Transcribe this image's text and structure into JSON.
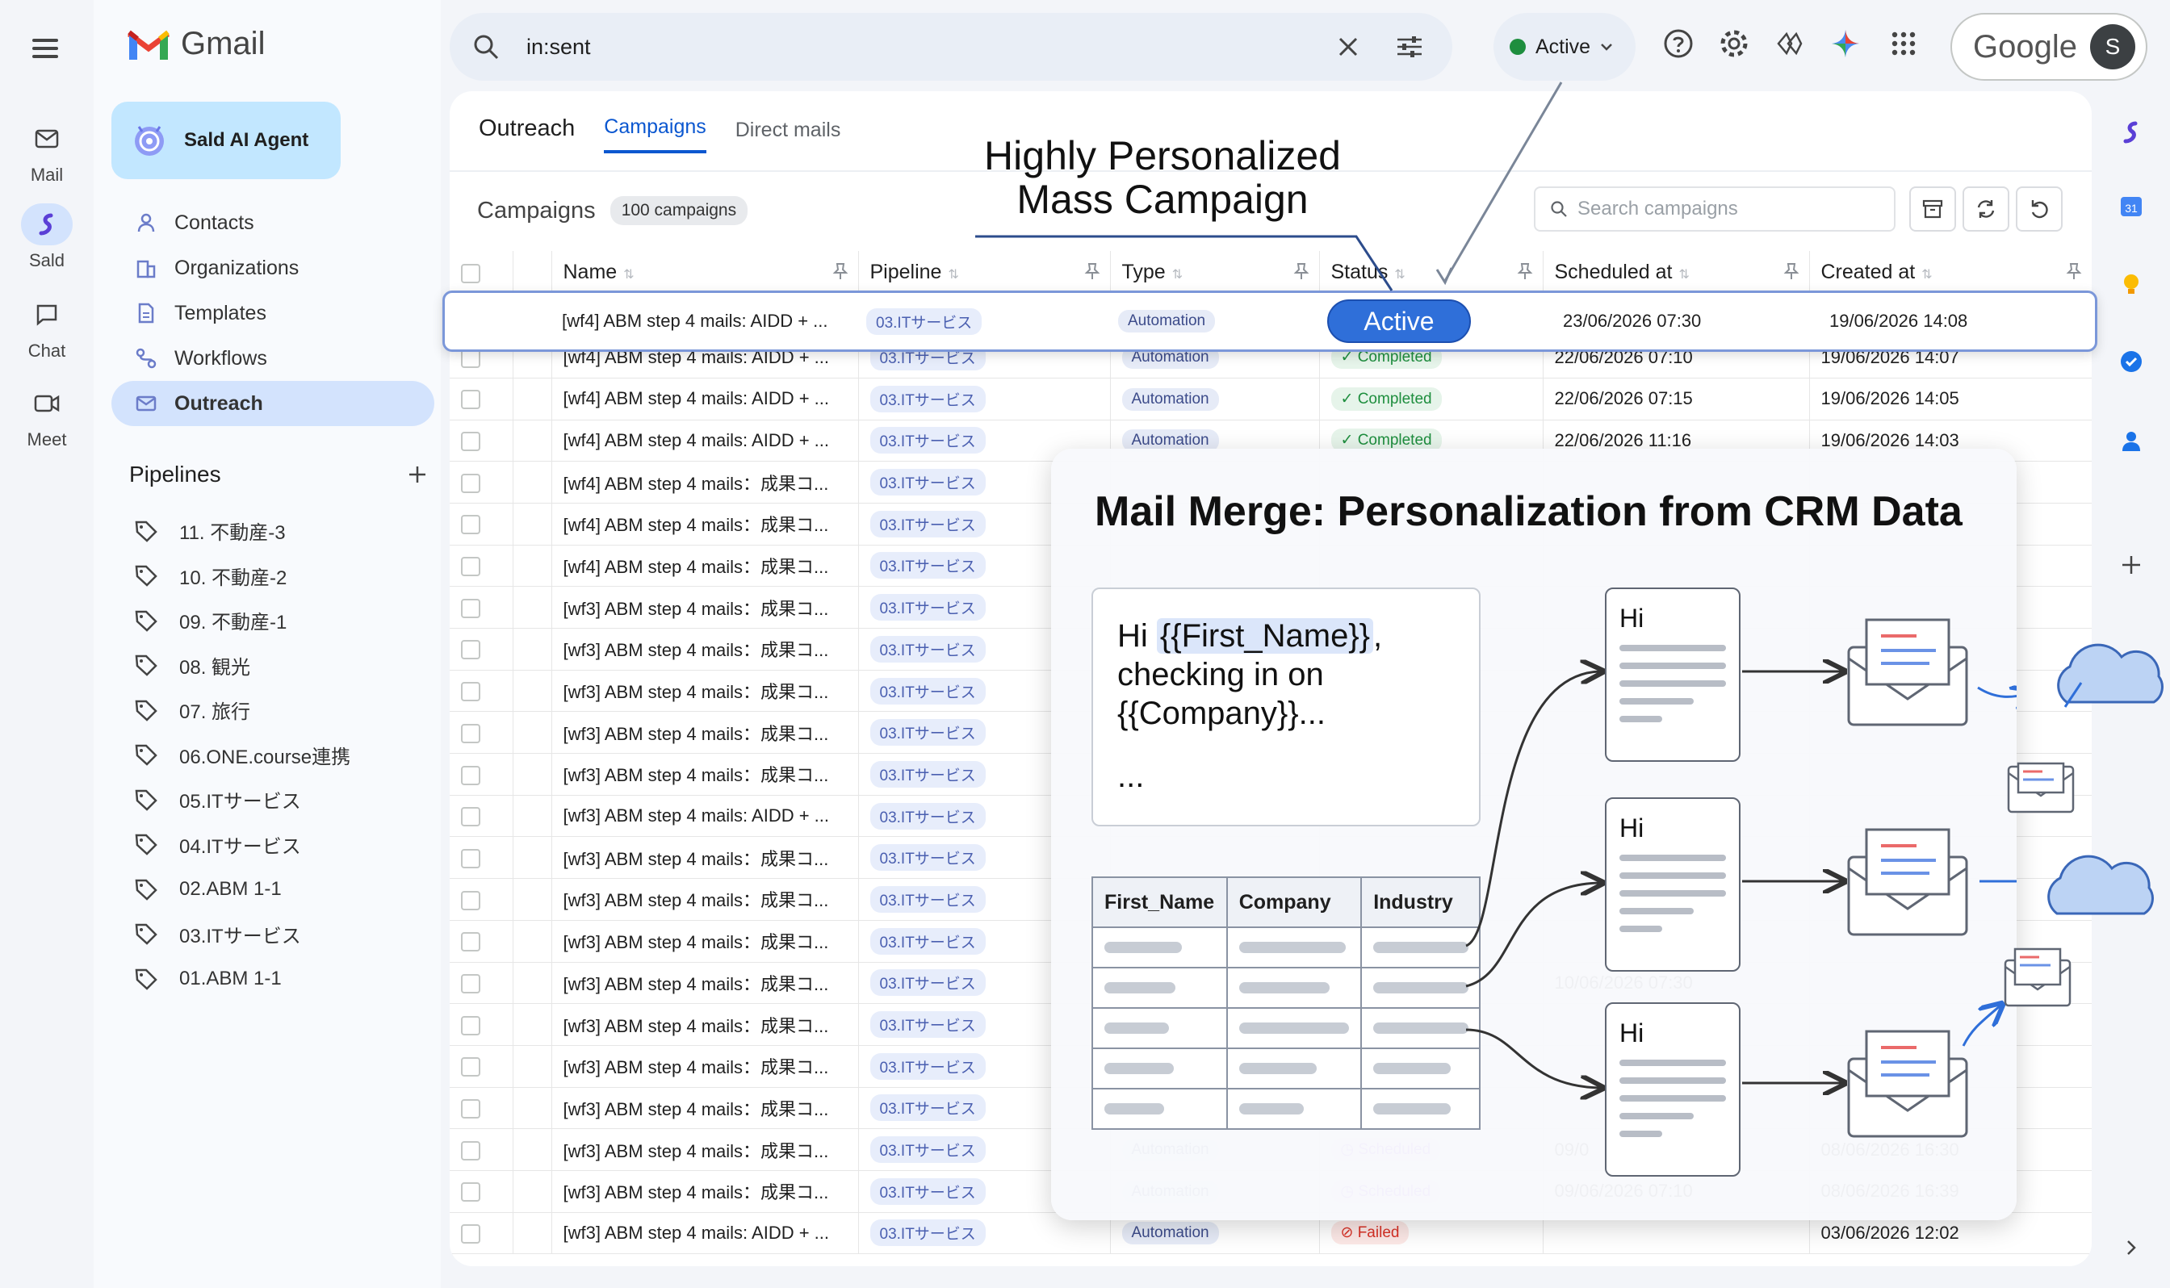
{
  "rail": {
    "items": [
      {
        "label": "Mail"
      },
      {
        "label": "Sald"
      },
      {
        "label": "Chat"
      },
      {
        "label": "Meet"
      }
    ]
  },
  "brand": {
    "name": "Gmail"
  },
  "agent": {
    "label": "Sald AI Agent"
  },
  "nav": [
    {
      "label": "Contacts"
    },
    {
      "label": "Organizations"
    },
    {
      "label": "Templates"
    },
    {
      "label": "Workflows"
    },
    {
      "label": "Outreach"
    }
  ],
  "pipelines": {
    "title": "Pipelines",
    "items": [
      "11. 不動産-3",
      "10. 不動産-2",
      "09. 不動産-1",
      "08. 観光",
      "07. 旅行",
      "06.ONE.course連携",
      "05.ITサービス",
      "04.ITサービス",
      "02.ABM 1-1",
      "03.ITサービス",
      "01.ABM 1-1"
    ]
  },
  "search": {
    "query": "in:sent"
  },
  "status": {
    "label": "Active",
    "color": "#1e8e3e"
  },
  "google": {
    "label": "Google",
    "avatar": "S"
  },
  "tabs": [
    "Outreach",
    "Campaigns",
    "Direct mails"
  ],
  "campaigns": {
    "title": "Campaigns",
    "count": "100 campaigns",
    "search_placeholder": "Search campaigns"
  },
  "table": {
    "columns": [
      "Name",
      "Pipeline",
      "Type",
      "Status",
      "Scheduled at",
      "Created at"
    ],
    "highlight": {
      "name": "[wf4] ABM step 4 mails: AIDD + ...",
      "pipeline": "03.ITサービス",
      "type": "Automation",
      "status": "Active",
      "scheduled": "23/06/2026 07:30",
      "created": "19/06/2026 14:08"
    },
    "rows": [
      {
        "name": "[wf4] ABM step 4 mails: AIDD + ...",
        "pipeline": "03.ITサービス",
        "type": "Automation",
        "status": "Completed",
        "scheduled": "22/06/2026 07:10",
        "created": "19/06/2026 14:07"
      },
      {
        "name": "[wf4] ABM step 4 mails: AIDD + ...",
        "pipeline": "03.ITサービス",
        "type": "Automation",
        "status": "Completed",
        "scheduled": "22/06/2026 07:15",
        "created": "19/06/2026 14:05"
      },
      {
        "name": "[wf4] ABM step 4 mails: AIDD + ...",
        "pipeline": "03.ITサービス",
        "type": "Automation",
        "status": "Completed",
        "scheduled": "22/06/2026 11:16",
        "created": "19/06/2026 14:03"
      },
      {
        "name": "[wf4] ABM step 4 mails：成果コ...",
        "pipeline": "03.ITサービス",
        "type": "",
        "status": "",
        "scheduled": "",
        "created": ""
      },
      {
        "name": "[wf4] ABM step 4 mails：成果コ...",
        "pipeline": "03.ITサービス",
        "type": "",
        "status": "",
        "scheduled": "",
        "created": ""
      },
      {
        "name": "[wf4] ABM step 4 mails：成果コ...",
        "pipeline": "03.ITサービス",
        "type": "",
        "status": "",
        "scheduled": "",
        "created": ""
      },
      {
        "name": "[wf3] ABM step 4 mails：成果コ...",
        "pipeline": "03.ITサービス",
        "type": "",
        "status": "",
        "scheduled": "",
        "created": ""
      },
      {
        "name": "[wf3] ABM step 4 mails：成果コ...",
        "pipeline": "03.ITサービス",
        "type": "",
        "status": "",
        "scheduled": "",
        "created": ""
      },
      {
        "name": "[wf3] ABM step 4 mails：成果コ...",
        "pipeline": "03.ITサービス",
        "type": "",
        "status": "",
        "scheduled": "",
        "created": ""
      },
      {
        "name": "[wf3] ABM step 4 mails：成果コ...",
        "pipeline": "03.ITサービス",
        "type": "",
        "status": "",
        "scheduled": "",
        "created": ""
      },
      {
        "name": "[wf3] ABM step 4 mails：成果コ...",
        "pipeline": "03.ITサービス",
        "type": "",
        "status": "",
        "scheduled": "",
        "created": ""
      },
      {
        "name": "[wf3] ABM step 4 mails: AIDD + ...",
        "pipeline": "03.ITサービス",
        "type": "",
        "status": "",
        "scheduled": "",
        "created": ""
      },
      {
        "name": "[wf3] ABM step 4 mails：成果コ...",
        "pipeline": "03.ITサービス",
        "type": "",
        "status": "",
        "scheduled": "",
        "created": ""
      },
      {
        "name": "[wf3] ABM step 4 mails：成果コ...",
        "pipeline": "03.ITサービス",
        "type": "",
        "status": "",
        "scheduled": "",
        "created": ""
      },
      {
        "name": "[wf3] ABM step 4 mails：成果コ...",
        "pipeline": "03.ITサービス",
        "type": "",
        "status": "",
        "scheduled": "",
        "created": ""
      },
      {
        "name": "[wf3] ABM step 4 mails：成果コ...",
        "pipeline": "03.ITサービス",
        "type": "",
        "status": "",
        "scheduled": "10/06/2026 07:30",
        "created": ""
      },
      {
        "name": "[wf3] ABM step 4 mails：成果コ...",
        "pipeline": "03.ITサービス",
        "type": "",
        "status": "",
        "scheduled": "",
        "created": ""
      },
      {
        "name": "[wf3] ABM step 4 mails：成果コ...",
        "pipeline": "03.ITサービス",
        "type": "",
        "status": "",
        "scheduled": "",
        "created": ""
      },
      {
        "name": "[wf3] ABM step 4 mails：成果コ...",
        "pipeline": "03.ITサービス",
        "type": "",
        "status": "",
        "scheduled": "",
        "created": ""
      },
      {
        "name": "[wf3] ABM step 4 mails：成果コ...",
        "pipeline": "03.ITサービス",
        "type": "Automation",
        "status": "Scheduled",
        "scheduled": "09/0",
        "created": "08/06/2026 16:30"
      },
      {
        "name": "[wf3] ABM step 4 mails：成果コ...",
        "pipeline": "03.ITサービス",
        "type": "Automation",
        "status": "Scheduled",
        "scheduled": "09/06/2026 07:10",
        "created": "08/06/2026 16:39"
      },
      {
        "name": "[wf3] ABM step 4 mails: AIDD + ...",
        "pipeline": "03.ITサービス",
        "type": "Automation",
        "status": "Failed",
        "scheduled": "",
        "created": "03/06/2026 12:02"
      }
    ]
  },
  "annotation": {
    "line1": "Highly Personalized",
    "line2": "Mass Campaign"
  },
  "overlay": {
    "title": "Mail Merge: Personalization from CRM Data",
    "template_prefix": "Hi ",
    "template_var": "{{First_Name}}",
    "template_rest": ", checking in on {{Company}}...",
    "template_tail": "...",
    "table_headers": [
      "First_Name",
      "Company",
      "Industry"
    ],
    "doc_greeting": "Hi"
  },
  "colors": {
    "accent": "#0b57d0",
    "selected_bg": "#d3e3fd",
    "active_blue": "#2f6fd9"
  }
}
